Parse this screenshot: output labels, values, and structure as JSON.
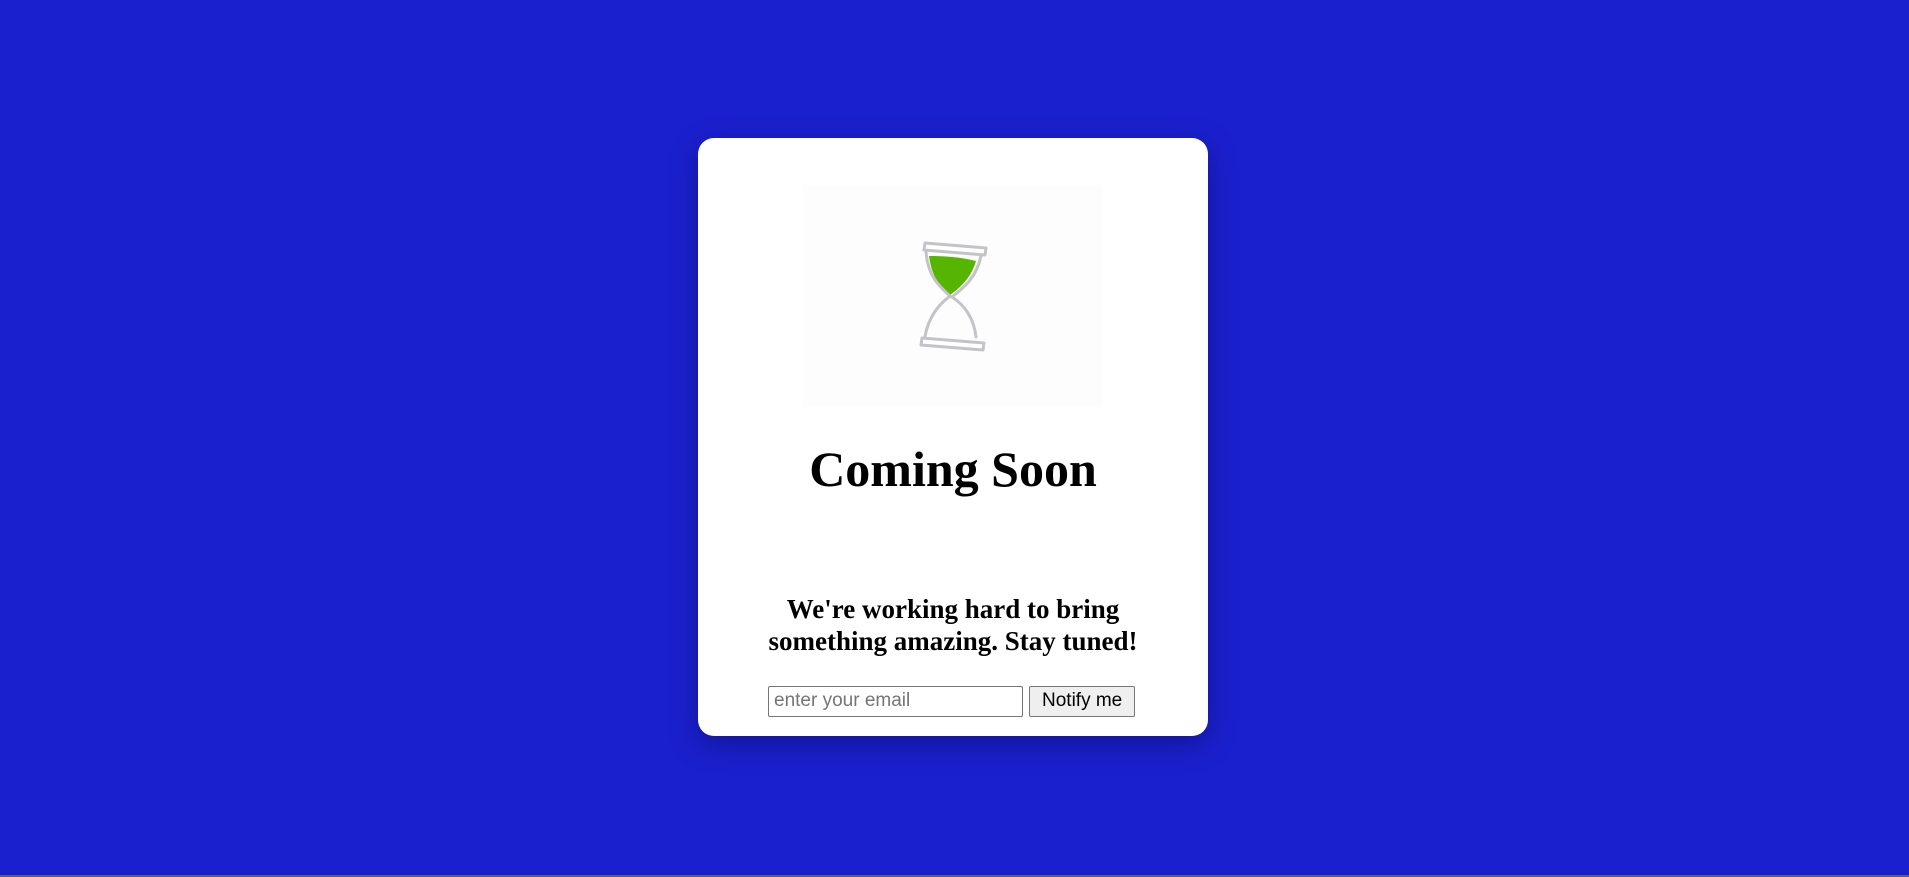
{
  "page": {
    "background_color": "#1b20cf"
  },
  "card": {
    "illustration": {
      "icon": "hourglass-icon",
      "sand_color": "#55b500",
      "frame_color": "#c4c4c8"
    },
    "title": "Coming Soon",
    "subtitle": "We're working hard to bring something amazing. Stay tuned!",
    "form": {
      "email_placeholder": "enter your email",
      "email_value": "",
      "notify_label": "Notify me"
    }
  }
}
